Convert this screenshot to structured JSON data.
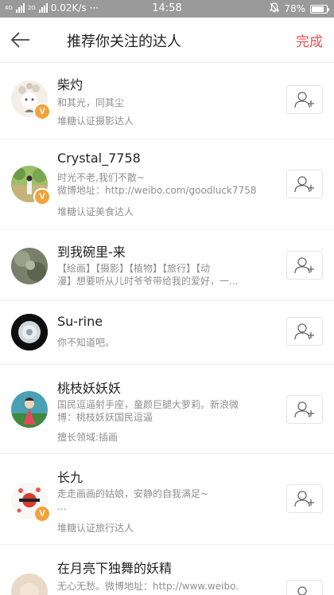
{
  "status_bar": {
    "network_labels": [
      "4G",
      "4G",
      "2G"
    ],
    "speed": "0.02K/s",
    "dots": "···",
    "time": "14:58",
    "battery": "78%",
    "battery_level": 0.78
  },
  "header": {
    "title": "推荐你关注的达人",
    "done_label": "完成",
    "accent_color": "#e8524b"
  },
  "verified_badge": "V",
  "users": [
    {
      "name": "柴灼",
      "bio": "和其光，同其尘",
      "cert": "堆糖认证摄影达人",
      "verified": true
    },
    {
      "name": "Crystal_7758",
      "bio": "时光不老,我们不散~\n微博地址：http://weibo.com/goodluck7758",
      "cert": "堆糖认证美食达人",
      "verified": true
    },
    {
      "name": "到我碗里-来",
      "bio": "【绘画】【摄影】【植物】【旅行】【动\n漫】想要听从儿时爷爷带给我的爱好，一...",
      "cert": "",
      "verified": false
    },
    {
      "name": "Su-rine",
      "bio": "你不知道吧。",
      "cert": "",
      "verified": false
    },
    {
      "name": "桃枝妖妖妖",
      "bio": "国民逗逼射手座，童颜巨腿大萝莉。新浪微\n博：桃枝妖妖国民逗逼",
      "cert": "擅长领域:插画",
      "verified": false
    },
    {
      "name": "长九",
      "bio": "走走画画的姑娘，安静的自我满足~\n...",
      "cert": "堆糖认证旅行达人",
      "verified": true
    },
    {
      "name": "在月亮下独舞的妖精",
      "bio": "无心无愁。微博地址：http://www.weibo.",
      "cert": "",
      "verified": false
    }
  ]
}
